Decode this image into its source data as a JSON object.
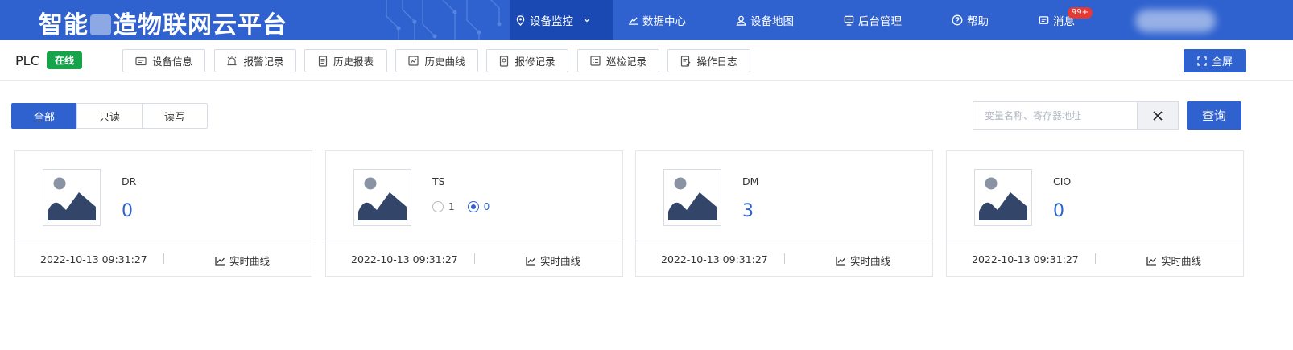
{
  "header": {
    "brand_prefix": "智能",
    "brand_suffix": "造物联网云平台",
    "nav": [
      {
        "label": "设备监控",
        "icon": "location-pin-icon",
        "active": true
      },
      {
        "label": "数据中心",
        "icon": "chart-icon"
      },
      {
        "label": "设备地图",
        "icon": "user-location-icon"
      },
      {
        "label": "后台管理",
        "icon": "monitor-icon"
      },
      {
        "label": "帮助",
        "icon": "help-icon"
      },
      {
        "label": "消息",
        "icon": "message-icon",
        "badge": "99+"
      }
    ]
  },
  "toolbar": {
    "device_name": "PLC",
    "status": "在线",
    "buttons": [
      "设备信息",
      "报警记录",
      "历史报表",
      "历史曲线",
      "报修记录",
      "巡检记录",
      "操作日志"
    ],
    "fullscreen_label": "全屏"
  },
  "filters": {
    "tabs": [
      "全部",
      "只读",
      "读写"
    ],
    "active_tab": "全部",
    "search_placeholder": "变量名称、寄存器地址",
    "search_value": "",
    "query_label": "查询"
  },
  "cards": [
    {
      "name": "DR",
      "value": "0",
      "timestamp": "2022-10-13 09:31:27",
      "curve_label": "实时曲线"
    },
    {
      "name": "TS",
      "radio_options": [
        "1",
        "0"
      ],
      "selected": "0",
      "timestamp": "2022-10-13 09:31:27",
      "curve_label": "实时曲线"
    },
    {
      "name": "DM",
      "value": "3",
      "timestamp": "2022-10-13 09:31:27",
      "curve_label": "实时曲线"
    },
    {
      "name": "CIO",
      "value": "0",
      "timestamp": "2022-10-13 09:31:27",
      "curve_label": "实时曲线"
    }
  ],
  "colors": {
    "primary": "#2f62cf",
    "nav_active": "#1a49b3",
    "online": "#16a34a",
    "badge": "#e53935"
  }
}
